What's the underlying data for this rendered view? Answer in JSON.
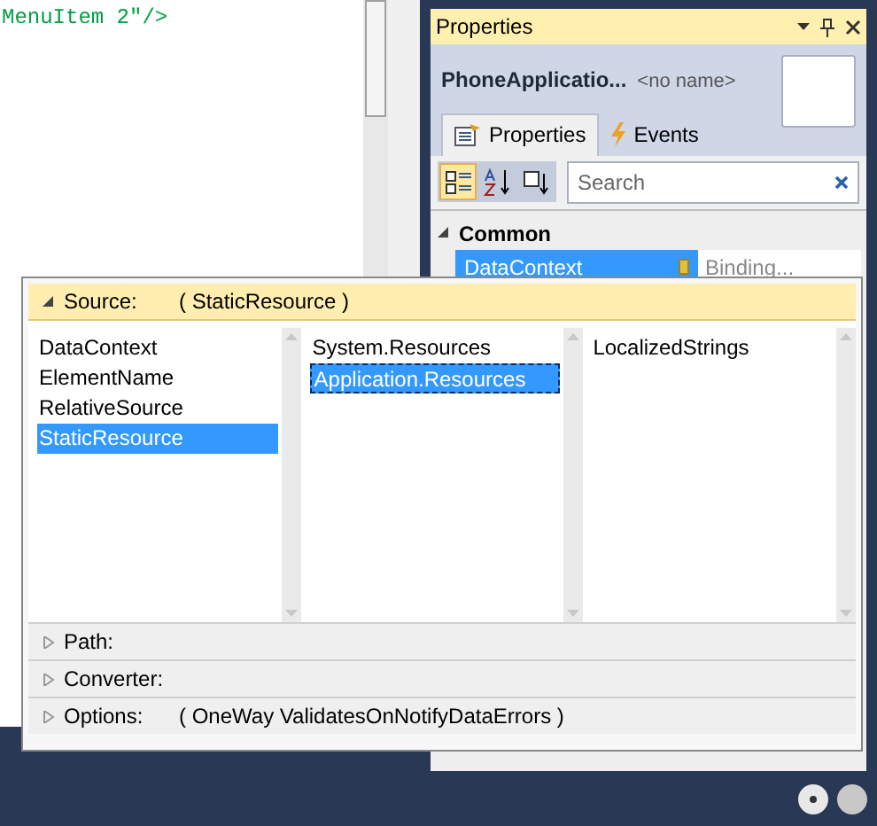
{
  "editor": {
    "lines": [
      "MenuItem 2\"/>"
    ]
  },
  "properties_panel": {
    "title": "Properties",
    "object_type": "PhoneApplicatio...",
    "object_name": "<no name>",
    "tabs": [
      {
        "kind": "properties",
        "label": "Properties",
        "selected": true
      },
      {
        "kind": "events",
        "label": "Events",
        "selected": false
      }
    ],
    "toolbar": [
      {
        "kind": "categorized",
        "selected": true
      },
      {
        "kind": "alphabetical",
        "selected": false
      },
      {
        "kind": "filter",
        "selected": false
      }
    ],
    "search": {
      "placeholder": "Search"
    },
    "category": {
      "label": "Common",
      "expanded": true
    },
    "rows": [
      {
        "name": "DataContext",
        "value": "Binding...",
        "selected": true
      }
    ]
  },
  "binding_editor": {
    "source": {
      "label": "Source:",
      "value": "( StaticResource )",
      "expanded": true
    },
    "lists": [
      {
        "items": [
          {
            "label": "DataContext",
            "selected": false
          },
          {
            "label": "ElementName",
            "selected": false
          },
          {
            "label": "RelativeSource",
            "selected": false
          },
          {
            "label": "StaticResource",
            "selected": true
          }
        ]
      },
      {
        "items": [
          {
            "label": "System.Resources",
            "selected": false
          },
          {
            "label": "Application.Resources",
            "selected": true
          }
        ]
      },
      {
        "items": [
          {
            "label": "LocalizedStrings",
            "selected": false
          }
        ]
      }
    ],
    "sections": [
      {
        "label": "Path:",
        "expanded": false
      },
      {
        "label": "Converter:",
        "expanded": false
      },
      {
        "label": "Options:",
        "value": "( OneWay ValidatesOnNotifyDataErrors )",
        "expanded": false
      }
    ]
  }
}
